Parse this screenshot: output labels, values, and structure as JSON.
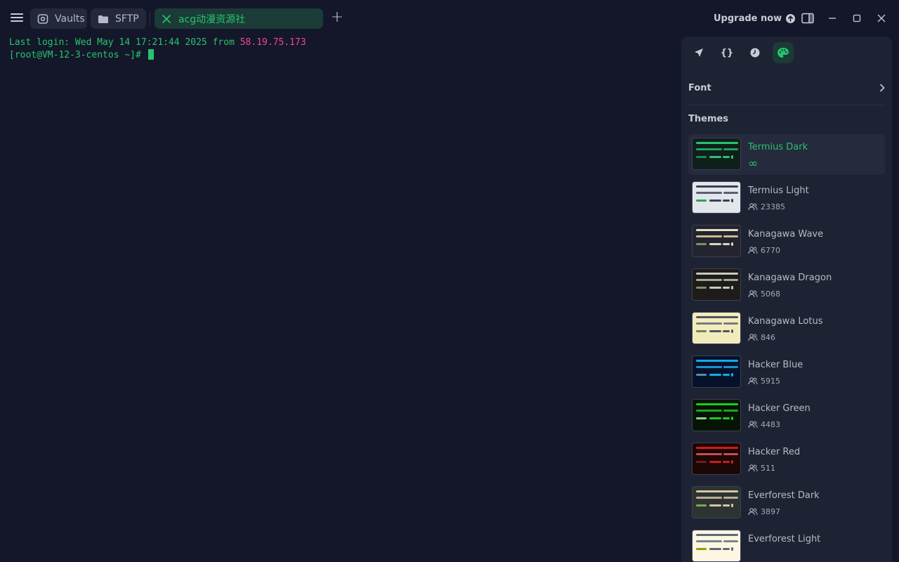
{
  "tabs": {
    "vaults": "Vaults",
    "sftp": "SFTP",
    "active": "acg动漫资源社"
  },
  "header": {
    "upgrade_label": "Upgrade now"
  },
  "terminal": {
    "login_prefix": "Last login: Wed May 14 17:21:44 2025 from ",
    "login_ip": "58.19.75.173",
    "prompt": "[root@VM-12-3-centos ~]# "
  },
  "panel": {
    "tools": [
      "rocket-icon",
      "braces-icon",
      "clock-icon",
      "palette-icon"
    ],
    "font_label": "Font",
    "themes_label": "Themes",
    "themes": [
      {
        "name": "Termius Dark",
        "count": "∞",
        "selected": true,
        "bg": "#0f1f1c",
        "bar": "#27c36f",
        "mid": "#1ea35b",
        "a": "#1d8a56",
        "b": "#27c36f"
      },
      {
        "name": "Termius Light",
        "count": "23385",
        "bg": "#e3e6ea",
        "bar": "#3a3f52",
        "mid": "#5a6072",
        "a": "#27a35b",
        "b": "#3a3f52"
      },
      {
        "name": "Kanagawa Wave",
        "count": "6770",
        "bg": "#242430",
        "bar": "#e6dfc2",
        "mid": "#cbb98f",
        "a": "#76946a",
        "b": "#dcd7ba"
      },
      {
        "name": "Kanagawa Dragon",
        "count": "5068",
        "bg": "#1d1c19",
        "bar": "#c5c9c5",
        "mid": "#a6a69c",
        "a": "#76946a",
        "b": "#c5c9c5"
      },
      {
        "name": "Kanagawa Lotus",
        "count": "846",
        "bg": "#f2ecbc",
        "bar": "#545464",
        "mid": "#7a7a84",
        "a": "#6f894e",
        "b": "#545464"
      },
      {
        "name": "Hacker Blue",
        "count": "5915",
        "bg": "#06122a",
        "bar": "#15a9ec",
        "mid": "#1e8fd0",
        "a": "#5c8aaa",
        "b": "#15a9ec"
      },
      {
        "name": "Hacker Green",
        "count": "4483",
        "bg": "#061406",
        "bar": "#22c922",
        "mid": "#1fa51f",
        "a": "#8ad08a",
        "b": "#22c922"
      },
      {
        "name": "Hacker Red",
        "count": "511",
        "bg": "#1c0606",
        "bar": "#d11a1a",
        "mid": "#c25050",
        "a": "#6b2020",
        "b": "#d11a1a"
      },
      {
        "name": "Everforest Dark",
        "count": "3897",
        "bg": "#2d3330",
        "bar": "#d3c6aa",
        "mid": "#b9ae94",
        "a": "#83a35b",
        "b": "#d3c6aa"
      },
      {
        "name": "Everforest Light",
        "count": "",
        "bg": "#fdf6e3",
        "bar": "#5c6a72",
        "mid": "#7a868c",
        "a": "#8da101",
        "b": "#5c6a72"
      }
    ]
  }
}
